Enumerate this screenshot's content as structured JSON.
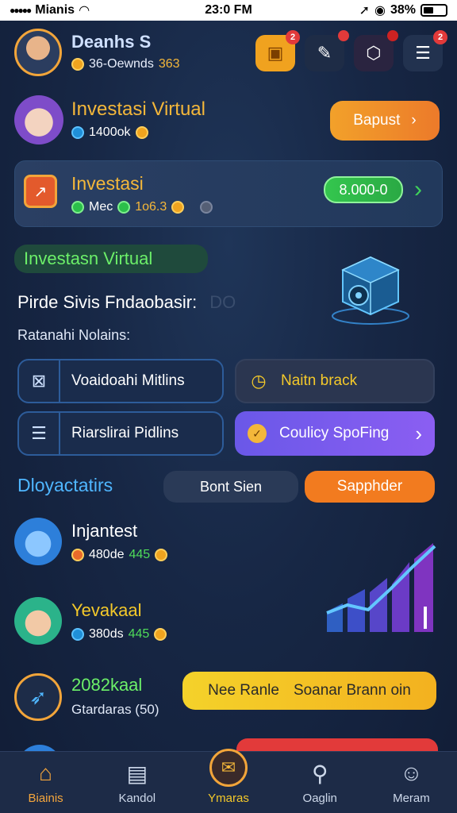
{
  "status_bar": {
    "carrier": "Mianis",
    "time": "23:0 FM",
    "battery": "38%"
  },
  "profile": {
    "name": "Deanhs S",
    "stats_text": "36-Oewnds",
    "stats_value": "363"
  },
  "header_buttons": [
    {
      "icon": "gift-icon",
      "badge": "2"
    },
    {
      "icon": "chat-icon",
      "badge": ""
    },
    {
      "icon": "network-icon",
      "badge": ""
    },
    {
      "icon": "menu-icon",
      "badge": "2"
    }
  ],
  "hero": {
    "title": "Investasi Virtual",
    "sub_text": "1400ok",
    "button_label": "Bapust"
  },
  "invest_card": {
    "title": "Investasi",
    "sub_label": "Mec",
    "sub_value": "1o6.3",
    "amount": "8.000-0"
  },
  "section": {
    "tag": "Investasn Virtual",
    "heading": "Pirde Sivis Fndaobasir:",
    "heading_suffix": "DO",
    "subheading": "Ratanahi Nolains:"
  },
  "tiles": [
    {
      "label": "Voaidoahi Mitlins",
      "icon": "chart-box-icon"
    },
    {
      "label": "Naitn brack",
      "icon": "timer-icon"
    },
    {
      "label": "Riarslirai Pidlins",
      "icon": "list-icon"
    },
    {
      "label": "Coulicy SpoFing",
      "icon": "check-badge-icon"
    }
  ],
  "leaderboard": {
    "title": "Dloyactatirs",
    "tab_a": "Bont Sien",
    "tab_b": "Sapphder",
    "entries": [
      {
        "name": "Injantest",
        "stat": "480de",
        "score": "445"
      },
      {
        "name": "Yevakaal",
        "stat": "380ds",
        "score": "445"
      },
      {
        "name": "2082kaal",
        "stat": "Gtardaras (50)",
        "score": ""
      }
    ],
    "cta_left": "Nee Ranle",
    "cta_right": "Soanar Brann oin"
  },
  "bottom_nav": [
    {
      "label": "Biainis",
      "icon": "home-icon"
    },
    {
      "label": "Kandol",
      "icon": "document-icon"
    },
    {
      "label": "Ymaras",
      "icon": "envelope-icon"
    },
    {
      "label": "Oaglin",
      "icon": "lock-icon"
    },
    {
      "label": "Meram",
      "icon": "support-icon"
    }
  ],
  "colors": {
    "accent_orange": "#f28a2a",
    "accent_green": "#35c44f",
    "accent_purple": "#7b5cf0",
    "accent_yellow": "#f4c92a",
    "text_gold": "#f4b73a"
  }
}
